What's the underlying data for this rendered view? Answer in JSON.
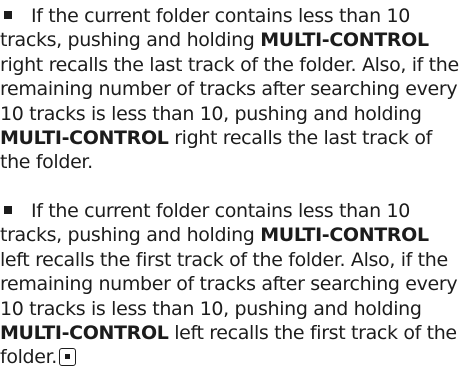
{
  "notes": [
    {
      "lines": [
        [
          "If the current folder contains less than 10"
        ],
        [
          "tracks, pushing and holding ",
          "MULTI-CONTROL"
        ],
        [
          "right recalls the last track of the folder. Also, if the"
        ],
        [
          "remaining number of tracks after searching every"
        ],
        [
          "10 tracks is less than 10, pushing and holding"
        ],
        [
          "MULTI-CONTROL",
          " right recalls the last track of"
        ],
        [
          "the folder."
        ]
      ]
    },
    {
      "lines": [
        [
          "If the current folder contains less than 10"
        ],
        [
          "tracks, pushing and holding ",
          "MULTI-CONTROL"
        ],
        [
          "left recalls the first track of the folder. Also, if the"
        ],
        [
          "remaining number of tracks after searching every"
        ],
        [
          "10 tracks is less than 10, pushing and holding"
        ],
        [
          "MULTI-CONTROL",
          " left recalls the first track of the"
        ],
        [
          "folder."
        ]
      ]
    }
  ],
  "end_mark_icon": "end-of-section-icon"
}
